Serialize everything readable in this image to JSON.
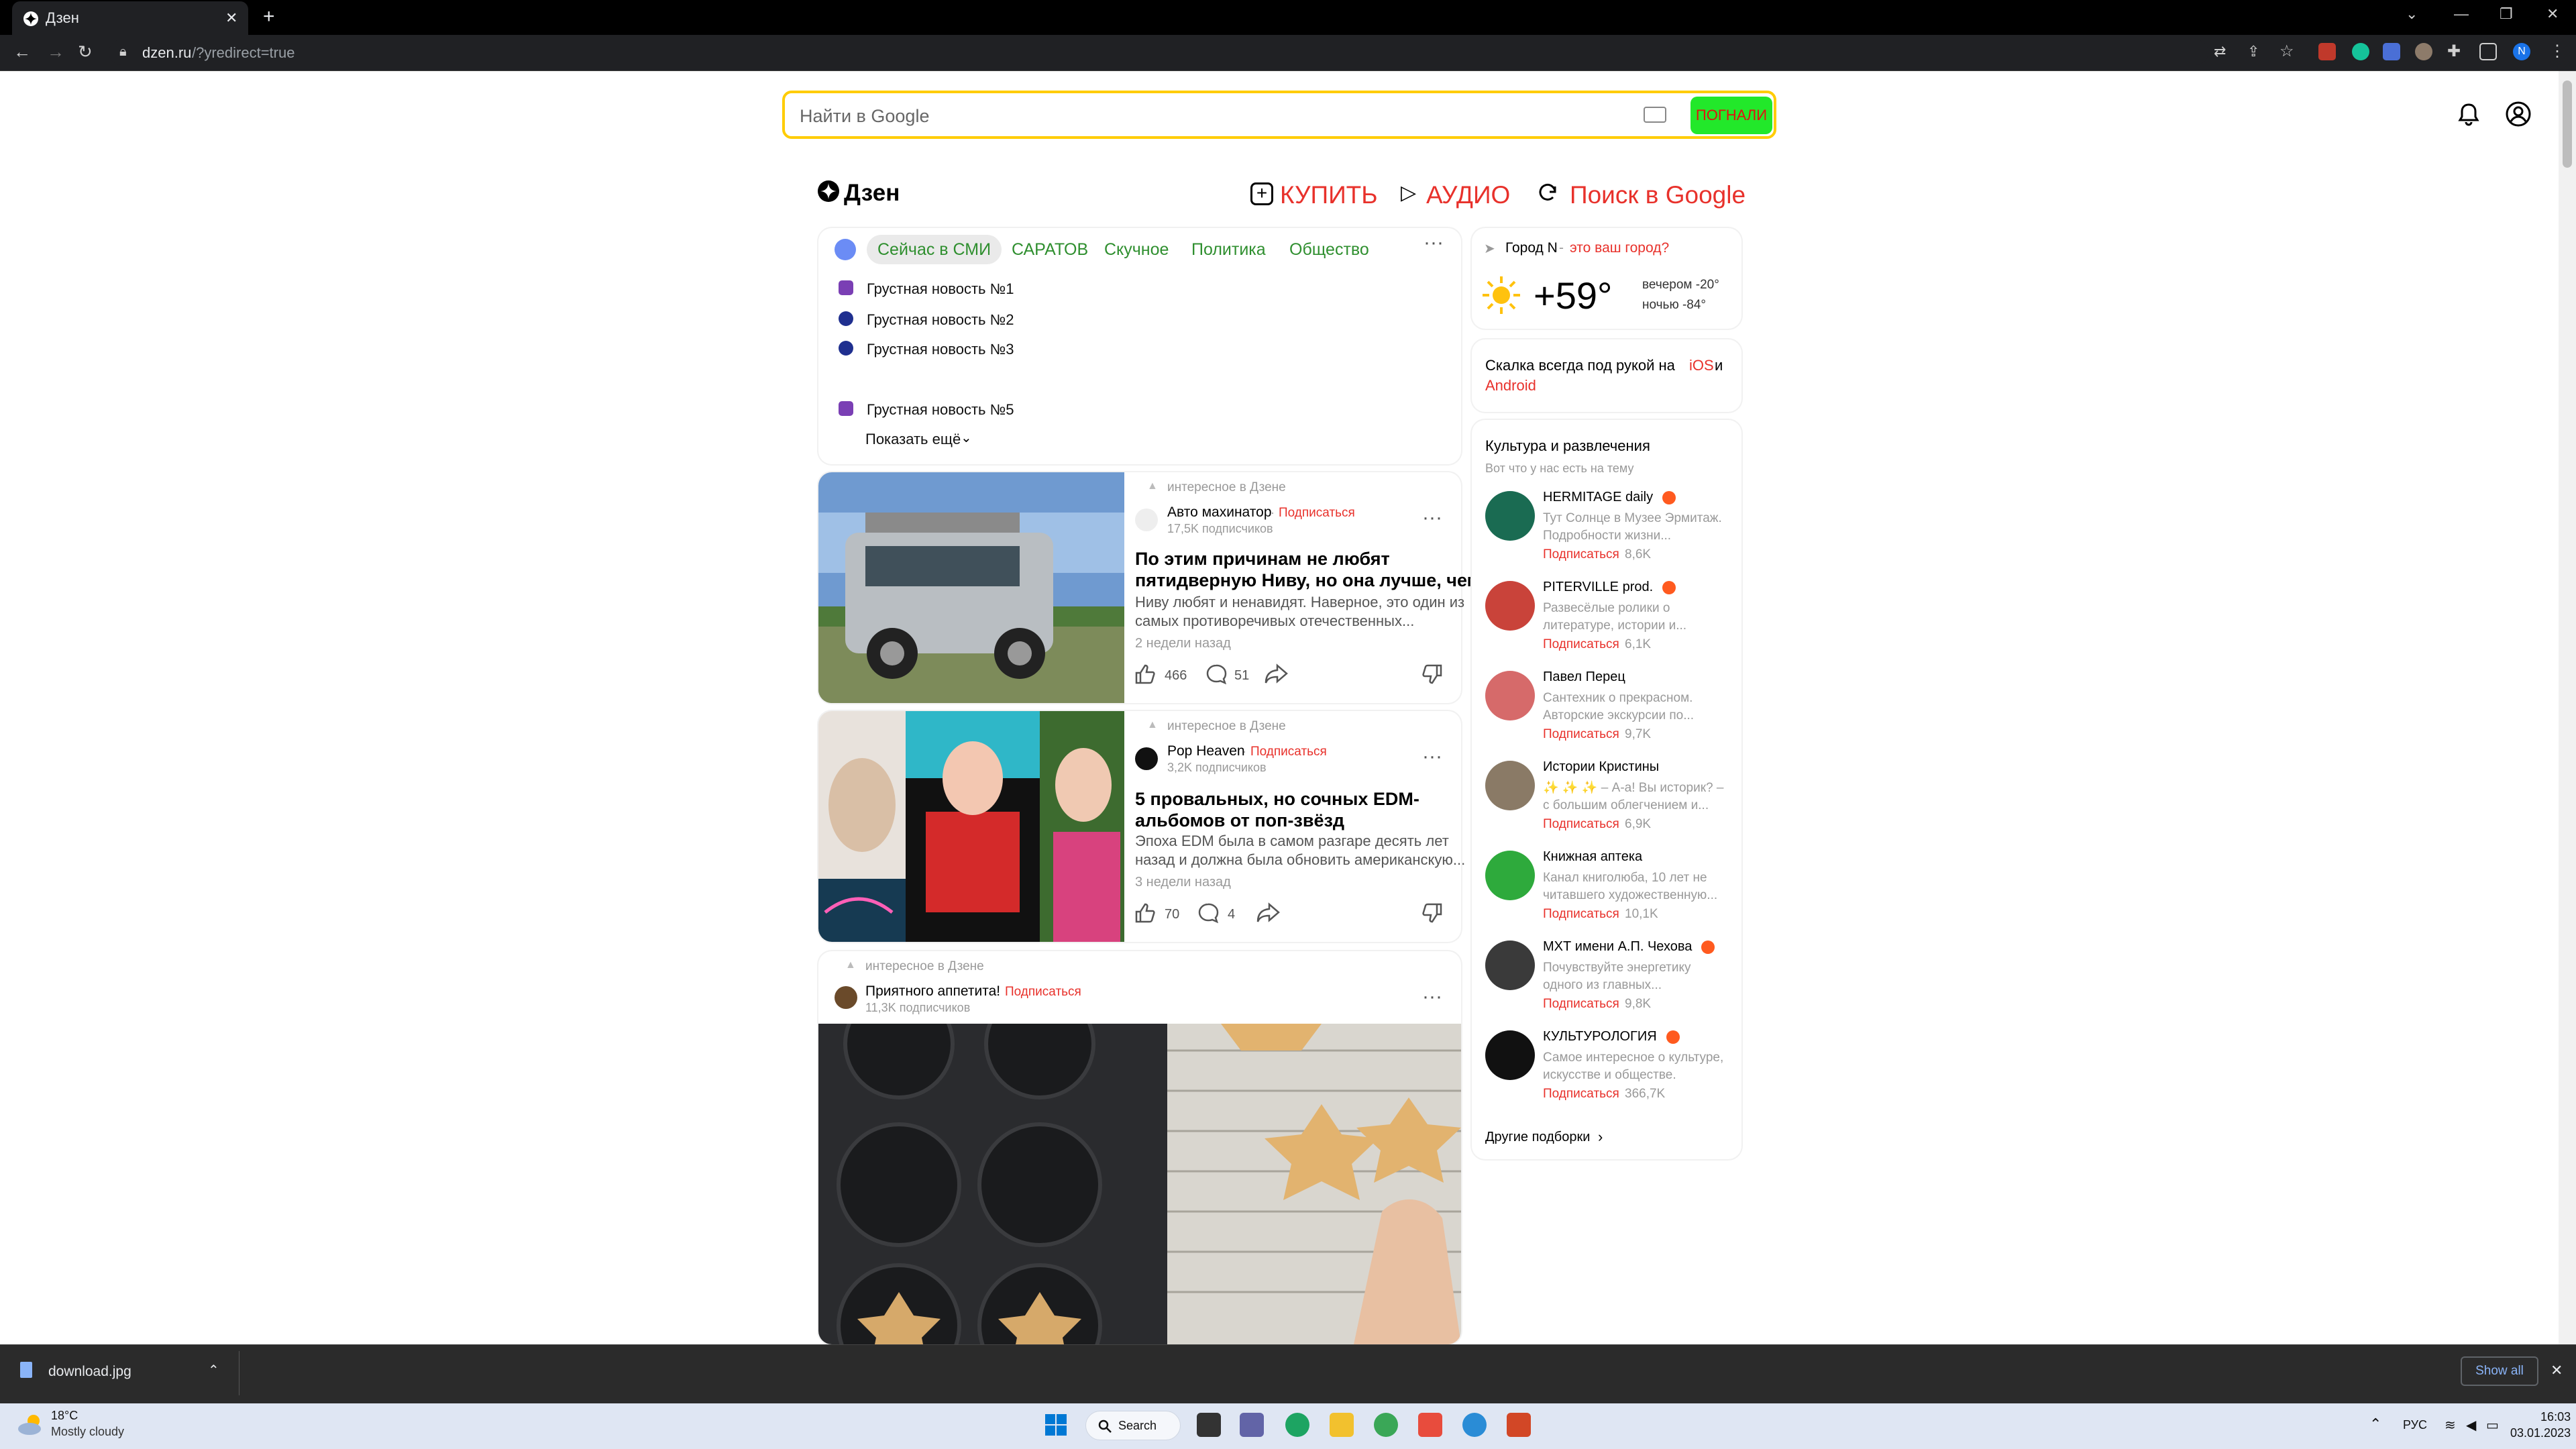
{
  "browser": {
    "tab_title": "Дзен",
    "url_host": "dzen.ru",
    "url_path": "/?yredirect=true"
  },
  "search": {
    "placeholder": "Найти в Google",
    "button": "ПОГНАЛИ"
  },
  "header": {
    "logo": "Дзен",
    "links": [
      "КУПИТЬ",
      "АУДИО",
      "Поиск в Google"
    ]
  },
  "news": {
    "tabs": [
      "Сейчас в СМИ",
      "САРАТОВ",
      "Скучное",
      "Политика",
      "Общество"
    ],
    "items": [
      "Грустная новость №1",
      "Грустная новость №2",
      "Грустная новость №3",
      "Грустная новость №5"
    ],
    "show_more": "Показать ещё"
  },
  "articles": [
    {
      "tag": "интересное в Дзене",
      "author": "Авто махинатор",
      "subscribe": "Подписаться",
      "subscribers": "17,5K подписчиков",
      "title_lines": [
        "По этим причинам не любят",
        "пятидверную Ниву, но она лучше, чем..."
      ],
      "desc_lines": [
        "Ниву любят и ненавидят. Наверное, это один из",
        "самых противоречивых отечественных..."
      ],
      "time": "2 недели назад",
      "likes": "466",
      "comments": "51"
    },
    {
      "tag": "интересное в Дзене",
      "author": "Pop Heaven",
      "subscribe": "Подписаться",
      "subscribers": "3,2K подписчиков",
      "title_lines": [
        "5 провальных, но сочных EDM-",
        "альбомов от поп-звёзд"
      ],
      "desc_lines": [
        "Эпоха EDM была в самом разгаре десять лет",
        "назад и должна была обновить американскую..."
      ],
      "time": "3 недели назад",
      "likes": "70",
      "comments": "4"
    },
    {
      "tag": "интересное в Дзене",
      "author": "Приятного аппетита!",
      "subscribe": "Подписаться",
      "subscribers": "11,3K подписчиков"
    }
  ],
  "weather": {
    "city": "Город N",
    "city_q": "это ваш город?",
    "temp": "+59°",
    "evening": "вечером -20°",
    "night": "ночью -84°"
  },
  "scala": {
    "text": "Скалка всегда под рукой на",
    "ios": "iOS",
    "and": "и",
    "android": "Android"
  },
  "culture": {
    "title": "Культура и развлечения",
    "subtitle": "Вот что у нас есть на тему",
    "channels": [
      {
        "name": "HERMITAGE daily",
        "d1": "Тут Солнце в Музее Эрмитаж.",
        "d2": "Подробности жизни...",
        "sub": "Подписаться",
        "count": "8,6K",
        "color": "#1a6b52"
      },
      {
        "name": "PITERVILLE prod.",
        "d1": "Развесёлые ролики о",
        "d2": "литературе, истории и...",
        "sub": "Подписаться",
        "count": "6,1K",
        "color": "#c9433a"
      },
      {
        "name": "Павел Перец",
        "d1": "Сантехник о прекрасном.",
        "d2": "Авторские экскурсии по...",
        "sub": "Подписаться",
        "count": "9,7K",
        "color": "#d66a6a"
      },
      {
        "name": "Истории Кристины",
        "d1": "✨ ✨ ✨ – А-а! Вы историк? –",
        "d2": "с большим облегчением и...",
        "sub": "Подписаться",
        "count": "6,9K",
        "color": "#8a7a66"
      },
      {
        "name": "Книжная аптека",
        "d1": "Канал книголюба, 10 лет не",
        "d2": "читавшего художественную...",
        "sub": "Подписаться",
        "count": "10,1K",
        "color": "#2eaa3c"
      },
      {
        "name": "МХТ имени А.П. Чехова",
        "d1": "Почувствуйте энергетику",
        "d2": "одного из главных...",
        "sub": "Подписаться",
        "count": "9,8K",
        "color": "#3a3a3a"
      },
      {
        "name": "КУЛЬТУРОЛОГИЯ",
        "d1": "Самое интересное о культуре,",
        "d2": "искусстве и обществе.",
        "sub": "Подписаться",
        "count": "366,7K",
        "color": "#111111"
      }
    ],
    "more": "Другие подборки"
  },
  "download": {
    "file": "download.jpg",
    "show_all": "Show all"
  },
  "taskbar": {
    "temp": "18°C",
    "cond": "Mostly cloudy",
    "search": "Search",
    "lang": "РУС",
    "time": "16:03",
    "date": "03.01.2023"
  }
}
